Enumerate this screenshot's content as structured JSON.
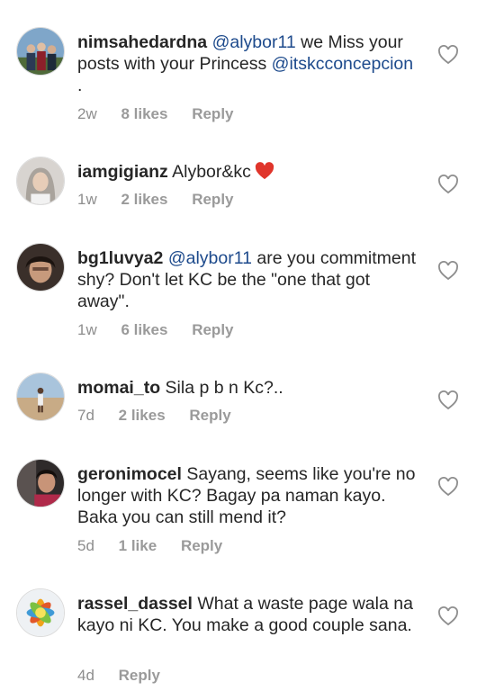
{
  "comments": [
    {
      "username": "nimsahedardna",
      "mention": "@alybor11",
      "text_after_mention": " we Miss your posts with your Princess ",
      "mention2": "@itskcconcepcion",
      "text_end": " .",
      "time": "2w",
      "likes": "8 likes",
      "reply": "Reply"
    },
    {
      "username": "iamgigianz",
      "text": "Alybor&kc",
      "emoji": "red-heart-emoji",
      "time": "1w",
      "likes": "2 likes",
      "reply": "Reply"
    },
    {
      "username": "bg1luvya2",
      "mention": "@alybor11",
      "text_after_mention": " are you commitment shy? Don't let KC be the \"one that got away\".",
      "time": "1w",
      "likes": "6 likes",
      "reply": "Reply"
    },
    {
      "username": "momai_to",
      "text": "Sila p b n Kc?..",
      "time": "7d",
      "likes": "2 likes",
      "reply": "Reply"
    },
    {
      "username": "geronimocel",
      "text": "Sayang, seems like you're no longer with KC? Bagay pa naman kayo. Baka you can still mend it?",
      "time": "5d",
      "likes": "1 like",
      "reply": "Reply"
    },
    {
      "username": "rassel_dassel",
      "text": "What a waste page wala na kayo ni KC. You make a good couple sana.",
      "time": "4d",
      "reply": "Reply"
    }
  ],
  "icons": {
    "like": "heart-outline-icon"
  },
  "colors": {
    "mention": "#1d4a8c",
    "meta": "#8e8e8e",
    "emoji_heart": "#e0352b"
  }
}
